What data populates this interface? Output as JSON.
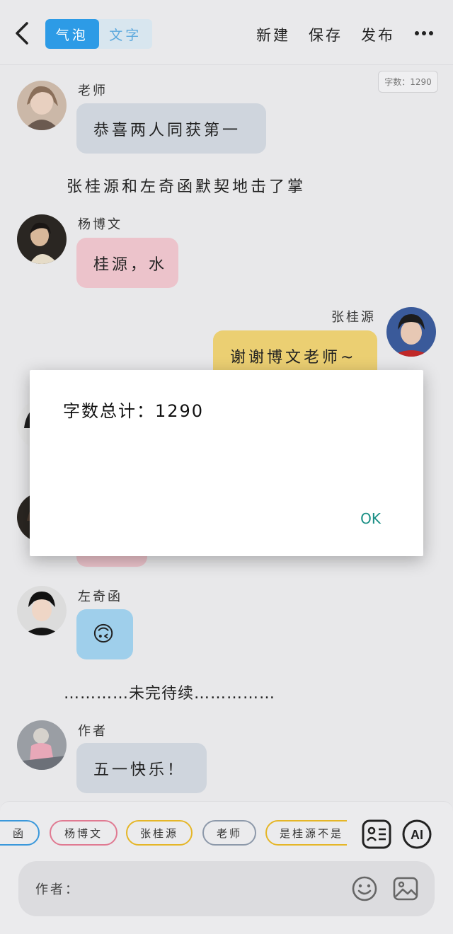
{
  "header": {
    "mode_tabs": [
      {
        "label": "气泡"
      },
      {
        "label": "文字"
      }
    ],
    "actions": [
      {
        "label": "新建"
      },
      {
        "label": "保存"
      },
      {
        "label": "发布"
      }
    ]
  },
  "word_count_badge": "字数：1290",
  "messages": [
    {
      "sender": "老师",
      "text": "恭喜两人同获第一"
    },
    {
      "narration": "张桂源和左奇函默契地击了掌"
    },
    {
      "sender": "杨博文",
      "text": "桂源，水"
    },
    {
      "sender": "张桂源",
      "text": "谢谢博文老师~"
    },
    {
      "sender": "左奇函",
      "emoji": "🙃"
    },
    {
      "narration": "…………未完待续……………"
    },
    {
      "sender": "作者",
      "text": "五一快乐！"
    }
  ],
  "dialog": {
    "message": "字数总计：1290",
    "ok_label": "OK"
  },
  "character_chips": [
    "函",
    "杨博文",
    "张桂源",
    "老师",
    "是桂源不是"
  ],
  "input": {
    "speaker_label": "作者："
  },
  "colors": {
    "accent": "#2d9be6",
    "chip_blue": "#3a98db",
    "chip_pink": "#e07a92",
    "chip_yellow": "#e5b628",
    "chip_grey": "#8d99aa",
    "ok_text": "#1a8f85"
  },
  "icons": [
    "back-arrow-icon",
    "more-icon",
    "contact-card-icon",
    "ai-icon",
    "emoji-icon",
    "image-icon"
  ]
}
